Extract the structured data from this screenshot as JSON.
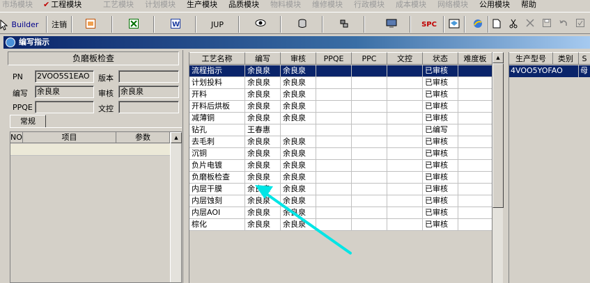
{
  "menu": {
    "items": [
      {
        "label": "市场模块",
        "enabled": false
      },
      {
        "label": "工程模块",
        "enabled": true,
        "checked": true
      },
      {
        "label": "工艺模块",
        "enabled": false
      },
      {
        "label": "计划模块",
        "enabled": false
      },
      {
        "label": "生产模块",
        "enabled": true
      },
      {
        "label": "品质模块",
        "enabled": true
      },
      {
        "label": "物料模块",
        "enabled": false
      },
      {
        "label": "维修模块",
        "enabled": false
      },
      {
        "label": "行政模块",
        "enabled": false
      },
      {
        "label": "成本模块",
        "enabled": false
      },
      {
        "label": "网络模块",
        "enabled": false
      },
      {
        "label": "公用模块",
        "enabled": true
      },
      {
        "label": "帮助",
        "enabled": true
      }
    ]
  },
  "toolbar": {
    "builder_label": "Builder",
    "logout_label": "注销",
    "jup_label": "JUP",
    "spc_label": "SPC"
  },
  "window": {
    "title": "编写指示"
  },
  "left": {
    "title": "负磨板检查",
    "pn_label": "PN",
    "pn_value": "2VOO5S1EAO",
    "version_label": "版本",
    "version_value": "",
    "writer_label": "编写",
    "writer_value": "余良泉",
    "reviewer_label": "审核",
    "reviewer_value": "余良泉",
    "ppqe_label": "PPQE",
    "ppqe_value": "",
    "wenkong_label": "文控",
    "wenkong_value": "",
    "tab_label": "常规",
    "subgrid_headers": {
      "no": "NO",
      "item": "项目",
      "param": "参数"
    }
  },
  "grid": {
    "headers": [
      "工艺名称",
      "编写",
      "审核",
      "PPQE",
      "PPC",
      "文控",
      "状态",
      "难度板"
    ],
    "selected_index": 0,
    "rows": [
      {
        "name": "流程指示",
        "writer": "余良泉",
        "reviewer": "余良泉",
        "ppqe": "",
        "ppc": "",
        "wenkong": "",
        "status": "已审核",
        "difficulty": ""
      },
      {
        "name": "计划投料",
        "writer": "余良泉",
        "reviewer": "余良泉",
        "ppqe": "",
        "ppc": "",
        "wenkong": "",
        "status": "已审核",
        "difficulty": ""
      },
      {
        "name": "开料",
        "writer": "余良泉",
        "reviewer": "余良泉",
        "ppqe": "",
        "ppc": "",
        "wenkong": "",
        "status": "已审核",
        "difficulty": ""
      },
      {
        "name": "开料后烘板",
        "writer": "余良泉",
        "reviewer": "余良泉",
        "ppqe": "",
        "ppc": "",
        "wenkong": "",
        "status": "已审核",
        "difficulty": ""
      },
      {
        "name": "减薄铜",
        "writer": "余良泉",
        "reviewer": "余良泉",
        "ppqe": "",
        "ppc": "",
        "wenkong": "",
        "status": "已审核",
        "difficulty": ""
      },
      {
        "name": "钻孔",
        "writer": "王春惠",
        "reviewer": "",
        "ppqe": "",
        "ppc": "",
        "wenkong": "",
        "status": "已编写",
        "difficulty": ""
      },
      {
        "name": "去毛刺",
        "writer": "余良泉",
        "reviewer": "余良泉",
        "ppqe": "",
        "ppc": "",
        "wenkong": "",
        "status": "已审核",
        "difficulty": ""
      },
      {
        "name": "沉铜",
        "writer": "余良泉",
        "reviewer": "余良泉",
        "ppqe": "",
        "ppc": "",
        "wenkong": "",
        "status": "已审核",
        "difficulty": ""
      },
      {
        "name": "负片电镀",
        "writer": "余良泉",
        "reviewer": "余良泉",
        "ppqe": "",
        "ppc": "",
        "wenkong": "",
        "status": "已审核",
        "difficulty": ""
      },
      {
        "name": "负磨板检查",
        "writer": "余良泉",
        "reviewer": "余良泉",
        "ppqe": "",
        "ppc": "",
        "wenkong": "",
        "status": "已审核",
        "difficulty": ""
      },
      {
        "name": "内层干膜",
        "writer": "余良泉",
        "reviewer": "余良泉",
        "ppqe": "",
        "ppc": "",
        "wenkong": "",
        "status": "已审核",
        "difficulty": ""
      },
      {
        "name": "内层蚀刻",
        "writer": "余良泉",
        "reviewer": "余良泉",
        "ppqe": "",
        "ppc": "",
        "wenkong": "",
        "status": "已审核",
        "difficulty": ""
      },
      {
        "name": "内层AOI",
        "writer": "余良泉",
        "reviewer": "余良泉",
        "ppqe": "",
        "ppc": "",
        "wenkong": "",
        "status": "已审核",
        "difficulty": ""
      },
      {
        "name": "棕化",
        "writer": "余良泉",
        "reviewer": "余良泉",
        "ppqe": "",
        "ppc": "",
        "wenkong": "",
        "status": "已审核",
        "difficulty": ""
      }
    ]
  },
  "right": {
    "headers": [
      "生产型号",
      "类别",
      "S"
    ],
    "row": {
      "model": "4VOO5YOFAO",
      "category": "母"
    }
  },
  "colors": {
    "selection": "#0a246a",
    "arrow": "#00e5e5",
    "face": "#d4d0c8"
  }
}
